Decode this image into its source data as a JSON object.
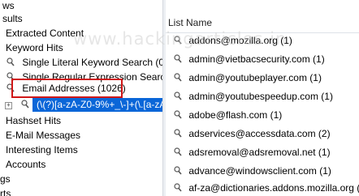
{
  "tree": {
    "items": [
      {
        "label": "ws"
      },
      {
        "label": "sults"
      },
      {
        "label": "Extracted Content"
      },
      {
        "label": "Keyword Hits"
      },
      {
        "label": "Single Literal Keyword Search (0)"
      },
      {
        "label": "Single Regular Expression Search (0"
      },
      {
        "label": "Email Addresses (1026)"
      },
      {
        "label": "(\\(?)[a-zA-Z0-9%+_\\-]+(\\.[a-zA"
      },
      {
        "label": "Hashset Hits"
      },
      {
        "label": "E-Mail Messages"
      },
      {
        "label": "Interesting Items"
      },
      {
        "label": "Accounts"
      },
      {
        "label": "gs"
      },
      {
        "label": "rts"
      }
    ]
  },
  "list": {
    "column_header": "List Name",
    "rows": [
      {
        "label": "addons@mozilla.org (1)"
      },
      {
        "label": "admin@vietbacsecurity.com (1)"
      },
      {
        "label": "admin@youtubeplayer.com (1)"
      },
      {
        "label": "admin@youtubespeedup.com (1)"
      },
      {
        "label": "adobe@flash.com (1)"
      },
      {
        "label": "adservices@accessdata.com (2)"
      },
      {
        "label": "adsremoval@adsremoval.net (1)"
      },
      {
        "label": "advance@windowsclient.com (1)"
      },
      {
        "label": "af-za@dictionaries.addons.mozilla.org (1)"
      }
    ]
  },
  "watermark": "www.hackingarticles.in",
  "colors": {
    "selection": "#0a66d8",
    "highlight_border": "#d01818"
  }
}
